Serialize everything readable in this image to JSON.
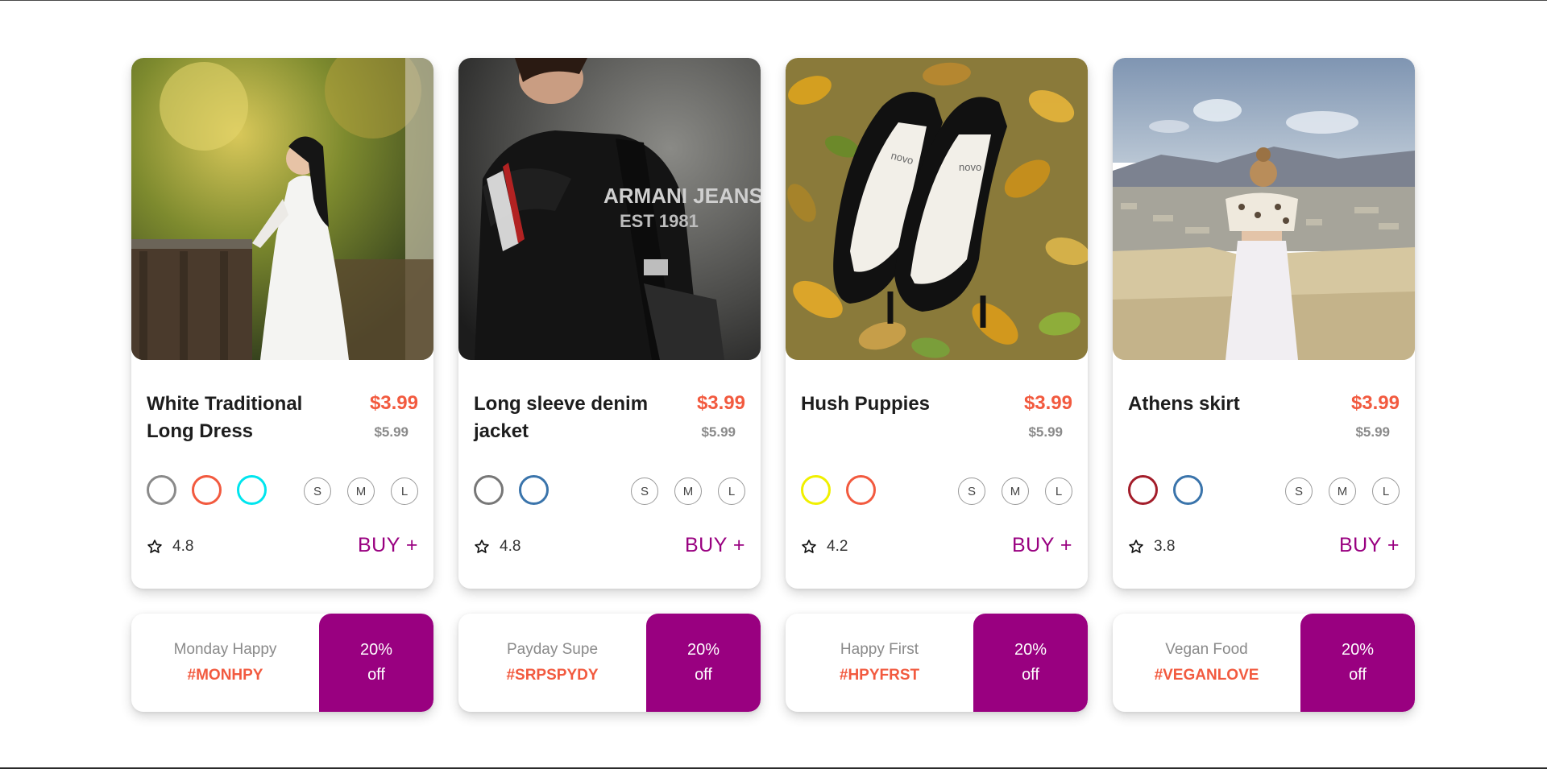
{
  "products": [
    {
      "name": "White Traditional Long Dress",
      "price": "$3.99",
      "old_price": "$5.99",
      "colors": [
        "#8a8a8a",
        "#f25a3f",
        "#00e5ee"
      ],
      "sizes": [
        "S",
        "M",
        "L"
      ],
      "rating": "4.8",
      "buy_label": "BUY +",
      "image": "woman-white-dress-photo"
    },
    {
      "name": "Long sleeve denim jacket",
      "price": "$3.99",
      "old_price": "$5.99",
      "colors": [
        "#777777",
        "#3a74ab"
      ],
      "sizes": [
        "S",
        "M",
        "L"
      ],
      "rating": "4.8",
      "buy_label": "BUY +",
      "image": "man-leather-jacket-photo"
    },
    {
      "name": "Hush Puppies",
      "price": "$3.99",
      "old_price": "$5.99",
      "colors": [
        "#f0f000",
        "#f25a3f"
      ],
      "sizes": [
        "S",
        "M",
        "L"
      ],
      "rating": "4.2",
      "buy_label": "BUY +",
      "image": "black-heels-leaves-photo"
    },
    {
      "name": "Athens skirt",
      "price": "$3.99",
      "old_price": "$5.99",
      "colors": [
        "#a31d2a",
        "#3a74ab"
      ],
      "sizes": [
        "S",
        "M",
        "L"
      ],
      "rating": "3.8",
      "buy_label": "BUY +",
      "image": "woman-athens-view-photo"
    }
  ],
  "coupons": [
    {
      "title": "Monday Happy",
      "code": "#MONHPY",
      "discount": "20%",
      "off": "off"
    },
    {
      "title": "Payday Supe",
      "code": "#SRPSPYDY",
      "discount": "20%",
      "off": "off"
    },
    {
      "title": "Happy First",
      "code": "#HPYFRST",
      "discount": "20%",
      "off": "off"
    },
    {
      "title": "Vegan Food",
      "code": "#VEGANLOVE",
      "discount": "20%",
      "off": "off"
    }
  ],
  "theme": {
    "accent": "#990080",
    "price": "#f25a3f"
  }
}
